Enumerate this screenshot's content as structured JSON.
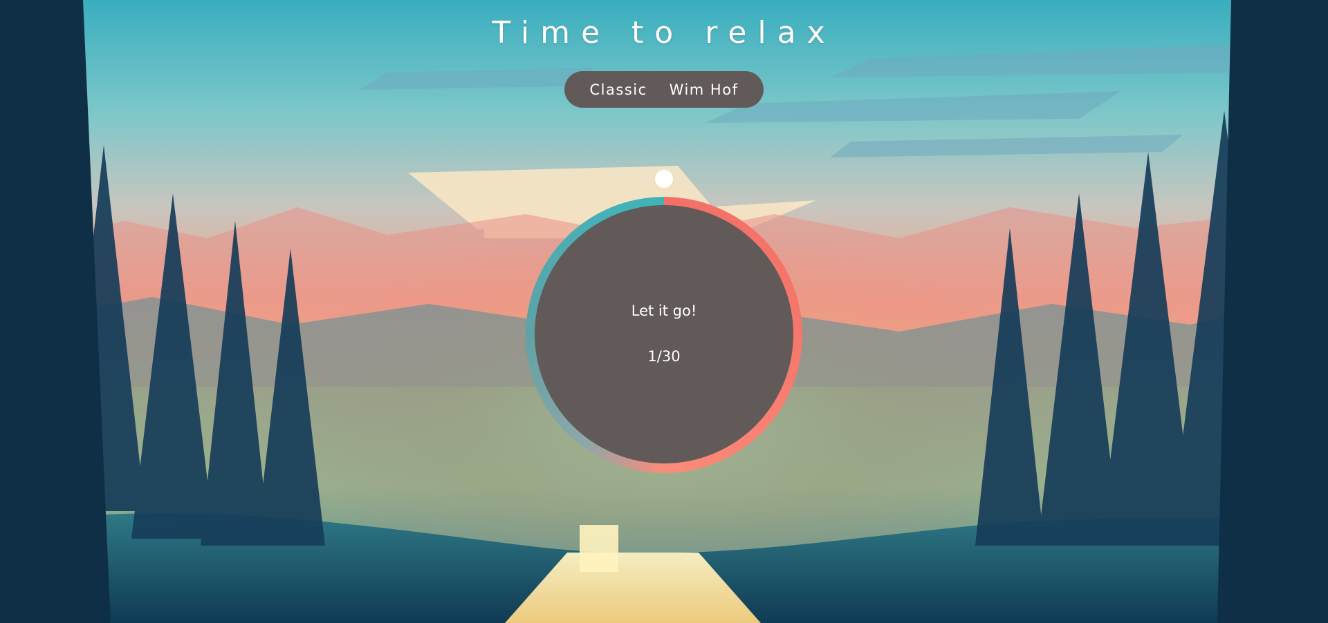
{
  "title": "Time to relax",
  "modes": [
    {
      "label": "Classic"
    },
    {
      "label": "Wim Hof"
    }
  ],
  "breath": {
    "instruction": "Let it go!",
    "counter": "1/30"
  },
  "colors": {
    "ring_primary": "#f47067",
    "ring_secondary": "#3fb3b8",
    "circle_fill": "#615a58",
    "pill_background": "#615a58"
  },
  "icons": {
    "progress_indicator": "dot-icon"
  }
}
